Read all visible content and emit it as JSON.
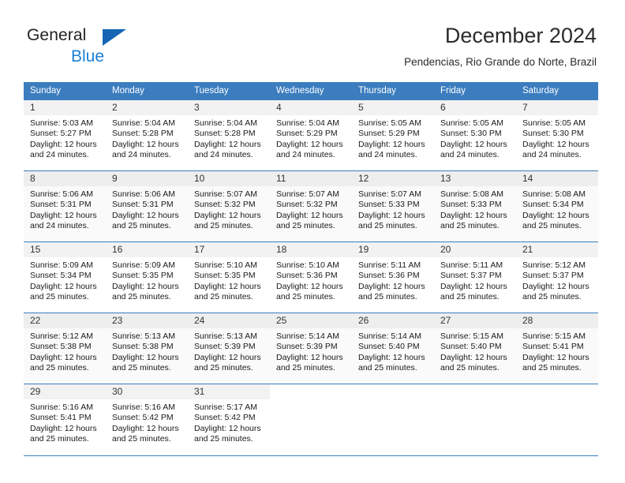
{
  "brand": {
    "name_top": "General",
    "name_bottom": "Blue",
    "triangle_color": "#1565b4",
    "blue_text_color": "#1b7fd4"
  },
  "header": {
    "title": "December 2024",
    "subtitle": "Pendencias, Rio Grande do Norte, Brazil"
  },
  "theme": {
    "header_bg": "#3b7dbf",
    "daynum_bg": "#f2f2f2",
    "alt_row_bg": "#fafafa",
    "text_color": "#1a1a1a"
  },
  "weekdays": [
    "Sunday",
    "Monday",
    "Tuesday",
    "Wednesday",
    "Thursday",
    "Friday",
    "Saturday"
  ],
  "weeks": [
    {
      "alt": false,
      "days": [
        {
          "num": "1",
          "sunrise": "Sunrise: 5:03 AM",
          "sunset": "Sunset: 5:27 PM",
          "daylight1": "Daylight: 12 hours",
          "daylight2": "and 24 minutes."
        },
        {
          "num": "2",
          "sunrise": "Sunrise: 5:04 AM",
          "sunset": "Sunset: 5:28 PM",
          "daylight1": "Daylight: 12 hours",
          "daylight2": "and 24 minutes."
        },
        {
          "num": "3",
          "sunrise": "Sunrise: 5:04 AM",
          "sunset": "Sunset: 5:28 PM",
          "daylight1": "Daylight: 12 hours",
          "daylight2": "and 24 minutes."
        },
        {
          "num": "4",
          "sunrise": "Sunrise: 5:04 AM",
          "sunset": "Sunset: 5:29 PM",
          "daylight1": "Daylight: 12 hours",
          "daylight2": "and 24 minutes."
        },
        {
          "num": "5",
          "sunrise": "Sunrise: 5:05 AM",
          "sunset": "Sunset: 5:29 PM",
          "daylight1": "Daylight: 12 hours",
          "daylight2": "and 24 minutes."
        },
        {
          "num": "6",
          "sunrise": "Sunrise: 5:05 AM",
          "sunset": "Sunset: 5:30 PM",
          "daylight1": "Daylight: 12 hours",
          "daylight2": "and 24 minutes."
        },
        {
          "num": "7",
          "sunrise": "Sunrise: 5:05 AM",
          "sunset": "Sunset: 5:30 PM",
          "daylight1": "Daylight: 12 hours",
          "daylight2": "and 24 minutes."
        }
      ]
    },
    {
      "alt": true,
      "days": [
        {
          "num": "8",
          "sunrise": "Sunrise: 5:06 AM",
          "sunset": "Sunset: 5:31 PM",
          "daylight1": "Daylight: 12 hours",
          "daylight2": "and 24 minutes."
        },
        {
          "num": "9",
          "sunrise": "Sunrise: 5:06 AM",
          "sunset": "Sunset: 5:31 PM",
          "daylight1": "Daylight: 12 hours",
          "daylight2": "and 25 minutes."
        },
        {
          "num": "10",
          "sunrise": "Sunrise: 5:07 AM",
          "sunset": "Sunset: 5:32 PM",
          "daylight1": "Daylight: 12 hours",
          "daylight2": "and 25 minutes."
        },
        {
          "num": "11",
          "sunrise": "Sunrise: 5:07 AM",
          "sunset": "Sunset: 5:32 PM",
          "daylight1": "Daylight: 12 hours",
          "daylight2": "and 25 minutes."
        },
        {
          "num": "12",
          "sunrise": "Sunrise: 5:07 AM",
          "sunset": "Sunset: 5:33 PM",
          "daylight1": "Daylight: 12 hours",
          "daylight2": "and 25 minutes."
        },
        {
          "num": "13",
          "sunrise": "Sunrise: 5:08 AM",
          "sunset": "Sunset: 5:33 PM",
          "daylight1": "Daylight: 12 hours",
          "daylight2": "and 25 minutes."
        },
        {
          "num": "14",
          "sunrise": "Sunrise: 5:08 AM",
          "sunset": "Sunset: 5:34 PM",
          "daylight1": "Daylight: 12 hours",
          "daylight2": "and 25 minutes."
        }
      ]
    },
    {
      "alt": false,
      "days": [
        {
          "num": "15",
          "sunrise": "Sunrise: 5:09 AM",
          "sunset": "Sunset: 5:34 PM",
          "daylight1": "Daylight: 12 hours",
          "daylight2": "and 25 minutes."
        },
        {
          "num": "16",
          "sunrise": "Sunrise: 5:09 AM",
          "sunset": "Sunset: 5:35 PM",
          "daylight1": "Daylight: 12 hours",
          "daylight2": "and 25 minutes."
        },
        {
          "num": "17",
          "sunrise": "Sunrise: 5:10 AM",
          "sunset": "Sunset: 5:35 PM",
          "daylight1": "Daylight: 12 hours",
          "daylight2": "and 25 minutes."
        },
        {
          "num": "18",
          "sunrise": "Sunrise: 5:10 AM",
          "sunset": "Sunset: 5:36 PM",
          "daylight1": "Daylight: 12 hours",
          "daylight2": "and 25 minutes."
        },
        {
          "num": "19",
          "sunrise": "Sunrise: 5:11 AM",
          "sunset": "Sunset: 5:36 PM",
          "daylight1": "Daylight: 12 hours",
          "daylight2": "and 25 minutes."
        },
        {
          "num": "20",
          "sunrise": "Sunrise: 5:11 AM",
          "sunset": "Sunset: 5:37 PM",
          "daylight1": "Daylight: 12 hours",
          "daylight2": "and 25 minutes."
        },
        {
          "num": "21",
          "sunrise": "Sunrise: 5:12 AM",
          "sunset": "Sunset: 5:37 PM",
          "daylight1": "Daylight: 12 hours",
          "daylight2": "and 25 minutes."
        }
      ]
    },
    {
      "alt": true,
      "days": [
        {
          "num": "22",
          "sunrise": "Sunrise: 5:12 AM",
          "sunset": "Sunset: 5:38 PM",
          "daylight1": "Daylight: 12 hours",
          "daylight2": "and 25 minutes."
        },
        {
          "num": "23",
          "sunrise": "Sunrise: 5:13 AM",
          "sunset": "Sunset: 5:38 PM",
          "daylight1": "Daylight: 12 hours",
          "daylight2": "and 25 minutes."
        },
        {
          "num": "24",
          "sunrise": "Sunrise: 5:13 AM",
          "sunset": "Sunset: 5:39 PM",
          "daylight1": "Daylight: 12 hours",
          "daylight2": "and 25 minutes."
        },
        {
          "num": "25",
          "sunrise": "Sunrise: 5:14 AM",
          "sunset": "Sunset: 5:39 PM",
          "daylight1": "Daylight: 12 hours",
          "daylight2": "and 25 minutes."
        },
        {
          "num": "26",
          "sunrise": "Sunrise: 5:14 AM",
          "sunset": "Sunset: 5:40 PM",
          "daylight1": "Daylight: 12 hours",
          "daylight2": "and 25 minutes."
        },
        {
          "num": "27",
          "sunrise": "Sunrise: 5:15 AM",
          "sunset": "Sunset: 5:40 PM",
          "daylight1": "Daylight: 12 hours",
          "daylight2": "and 25 minutes."
        },
        {
          "num": "28",
          "sunrise": "Sunrise: 5:15 AM",
          "sunset": "Sunset: 5:41 PM",
          "daylight1": "Daylight: 12 hours",
          "daylight2": "and 25 minutes."
        }
      ]
    },
    {
      "alt": false,
      "days": [
        {
          "num": "29",
          "sunrise": "Sunrise: 5:16 AM",
          "sunset": "Sunset: 5:41 PM",
          "daylight1": "Daylight: 12 hours",
          "daylight2": "and 25 minutes."
        },
        {
          "num": "30",
          "sunrise": "Sunrise: 5:16 AM",
          "sunset": "Sunset: 5:42 PM",
          "daylight1": "Daylight: 12 hours",
          "daylight2": "and 25 minutes."
        },
        {
          "num": "31",
          "sunrise": "Sunrise: 5:17 AM",
          "sunset": "Sunset: 5:42 PM",
          "daylight1": "Daylight: 12 hours",
          "daylight2": "and 25 minutes."
        },
        null,
        null,
        null,
        null
      ]
    }
  ]
}
